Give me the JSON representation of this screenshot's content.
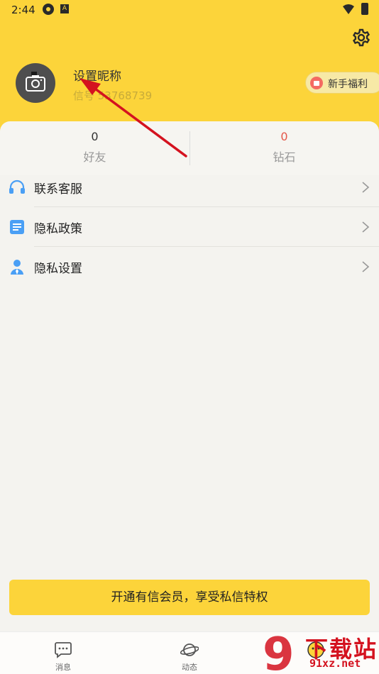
{
  "status_bar": {
    "time": "2:44",
    "icon_small": "A"
  },
  "profile": {
    "nickname": "设置昵称",
    "id_text": "信号 53768739",
    "welfare_label": "新手福利"
  },
  "stats": [
    {
      "value": "0",
      "label": "好友",
      "value_color": "#333333"
    },
    {
      "value": "0",
      "label": "钻石",
      "value_color": "#e4574a"
    }
  ],
  "menu": [
    {
      "label": "联系客服",
      "icon": "headset-icon"
    },
    {
      "label": "隐私政策",
      "icon": "document-icon"
    },
    {
      "label": "隐私设置",
      "icon": "user-icon"
    }
  ],
  "vip_button": {
    "label": "开通有信会员，享受私信特权"
  },
  "tabs": [
    {
      "label": "消息",
      "icon": "chat-icon"
    },
    {
      "label": "动态",
      "icon": "planet-icon"
    },
    {
      "label": "",
      "icon": "profile-icon"
    }
  ],
  "watermark": {
    "title": "下载站",
    "url": "91xz.net",
    "logo_text": "9"
  },
  "colors": {
    "brand_yellow": "#fcd43a",
    "accent_red": "#e4574a",
    "icon_blue": "#4a9ff5",
    "annotation_red": "#d4121f"
  }
}
